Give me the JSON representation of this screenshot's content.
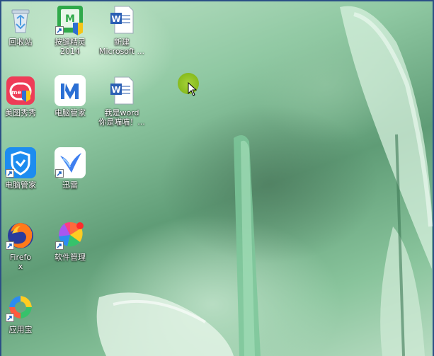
{
  "desktop": {
    "icons": [
      {
        "id": "recycle-bin",
        "label": "回收站",
        "icon": "recycle-bin-icon"
      },
      {
        "id": "anjian",
        "label": "按键精灵 2014",
        "icon": "anjian-icon"
      },
      {
        "id": "word-new",
        "label": "新建 Microsoft ...",
        "icon": "word-doc-icon"
      },
      {
        "id": "meitu",
        "label": "美图秀秀",
        "icon": "meitu-icon"
      },
      {
        "id": "pc-manager-1",
        "label": "电脑管家",
        "icon": "pc-manager-icon"
      },
      {
        "id": "word-doc",
        "label": "我是word你是喵喵！...",
        "icon": "word-doc-icon"
      },
      {
        "id": "pc-manager-2",
        "label": "电脑管家",
        "icon": "tencent-shield-icon"
      },
      {
        "id": "xunlei",
        "label": "迅雷",
        "icon": "xunlei-icon"
      },
      {
        "id": "firefox",
        "label": "Firefox",
        "icon": "firefox-icon"
      },
      {
        "id": "software-mgr",
        "label": "软件管理",
        "icon": "software-manager-icon"
      },
      {
        "id": "app-store",
        "label": "应用宝",
        "icon": "yingyongbao-icon"
      }
    ]
  }
}
